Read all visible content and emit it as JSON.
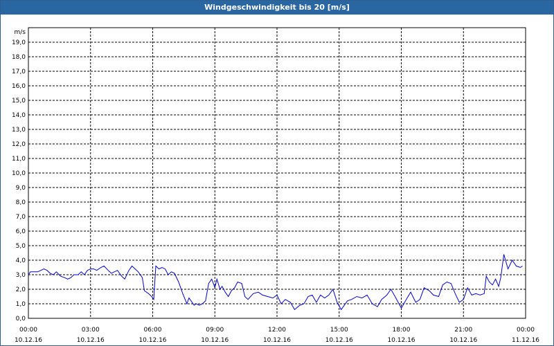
{
  "chart_title": "Windgeschwindigkeit bis 20 [m/s]",
  "chart_data": {
    "type": "line",
    "title": "Windgeschwindigkeit bis 20 [m/s]",
    "unit_label": "m/s",
    "ylim": [
      0,
      20
    ],
    "yticks": [
      "0,0",
      "1,0",
      "2,0",
      "3,0",
      "4,0",
      "5,0",
      "6,0",
      "7,0",
      "8,0",
      "9,0",
      "10,0",
      "11,0",
      "12,0",
      "13,0",
      "14,0",
      "15,0",
      "16,0",
      "17,0",
      "18,0",
      "19,0"
    ],
    "xlim_hours": [
      0,
      24
    ],
    "xticks": [
      {
        "time": "00:00",
        "date": "10.12.16"
      },
      {
        "time": "03:00",
        "date": "10.12.16"
      },
      {
        "time": "06:00",
        "date": "10.12.16"
      },
      {
        "time": "09:00",
        "date": "10.12.16"
      },
      {
        "time": "12:00",
        "date": "10.12.16"
      },
      {
        "time": "15:00",
        "date": "10.12.16"
      },
      {
        "time": "18:00",
        "date": "10.12.16"
      },
      {
        "time": "21:00",
        "date": "10.12.16"
      },
      {
        "time": "00:00",
        "date": "11.12.16"
      }
    ],
    "grid": true,
    "line_color": "#0000cc",
    "series": [
      {
        "x": [
          0.0,
          0.1,
          0.25,
          0.45,
          0.6,
          0.75,
          0.9,
          1.05,
          1.2,
          1.35,
          1.55,
          1.75,
          1.9,
          2.05,
          2.2,
          2.4,
          2.55,
          2.7,
          2.85,
          3.0,
          3.15,
          3.3,
          3.5,
          3.65,
          3.85,
          4.0,
          4.15,
          4.3,
          4.5,
          4.65,
          4.85,
          5.0,
          5.15,
          5.3,
          5.5,
          5.6,
          5.8,
          5.95,
          6.05,
          6.15,
          6.3,
          6.45,
          6.6,
          6.75,
          6.9,
          7.05,
          7.25,
          7.45,
          7.65,
          7.75,
          8.0,
          8.1,
          8.25,
          8.4,
          8.55,
          8.7,
          8.85,
          9.0,
          9.1,
          9.25,
          9.35,
          9.5,
          9.65,
          9.8,
          9.95,
          10.1,
          10.3,
          10.45,
          10.6,
          10.85,
          11.1,
          11.3,
          11.55,
          11.8,
          12.0,
          12.2,
          12.4,
          12.65,
          12.85,
          13.1,
          13.3,
          13.5,
          13.7,
          13.9,
          14.1,
          14.3,
          14.5,
          14.7,
          14.9,
          15.1,
          15.4,
          15.6,
          15.85,
          16.1,
          16.35,
          16.6,
          16.85,
          17.05,
          17.3,
          17.5,
          17.7,
          17.85,
          18.0,
          18.2,
          18.45,
          18.7,
          18.9,
          19.1,
          19.35,
          19.55,
          19.8,
          20.0,
          20.2,
          20.4,
          20.6,
          20.8,
          21.0,
          21.2,
          21.4,
          21.6,
          21.8,
          22.0,
          22.1,
          22.25,
          22.4,
          22.55,
          22.7,
          22.8,
          22.95,
          23.15,
          23.35,
          23.55,
          23.75,
          23.85
        ],
        "y": [
          3.0,
          3.2,
          3.2,
          3.2,
          3.3,
          3.4,
          3.3,
          3.1,
          3.0,
          3.2,
          2.9,
          2.8,
          2.7,
          2.8,
          3.0,
          3.0,
          3.2,
          3.0,
          3.3,
          3.4,
          3.4,
          3.3,
          3.5,
          3.6,
          3.3,
          3.1,
          3.2,
          3.3,
          2.9,
          2.7,
          3.3,
          3.6,
          3.4,
          3.2,
          2.8,
          1.9,
          1.7,
          1.5,
          1.3,
          3.6,
          3.4,
          3.5,
          3.4,
          3.0,
          3.2,
          3.1,
          2.5,
          1.7,
          1.0,
          1.4,
          0.9,
          1.0,
          0.9,
          1.0,
          1.2,
          2.4,
          2.7,
          2.1,
          2.7,
          2.0,
          2.2,
          1.8,
          1.5,
          1.9,
          2.1,
          2.5,
          2.4,
          1.5,
          1.3,
          1.7,
          1.8,
          1.6,
          1.5,
          1.4,
          1.6,
          1.0,
          1.3,
          1.1,
          0.6,
          0.9,
          1.0,
          1.5,
          1.6,
          1.1,
          1.6,
          1.4,
          1.6,
          2.0,
          1.1,
          0.6,
          1.2,
          1.3,
          1.5,
          1.4,
          1.6,
          1.0,
          0.8,
          1.3,
          1.6,
          2.0,
          1.5,
          1.1,
          0.7,
          1.2,
          1.8,
          1.1,
          1.3,
          2.1,
          1.9,
          1.6,
          1.5,
          2.3,
          2.5,
          2.4,
          1.7,
          1.1,
          1.3,
          2.1,
          1.6,
          1.7,
          1.6,
          1.7,
          2.9,
          2.5,
          2.3,
          2.7,
          2.2,
          2.8,
          4.4,
          3.4,
          4.0,
          3.6,
          3.5,
          3.6
        ]
      }
    ]
  }
}
